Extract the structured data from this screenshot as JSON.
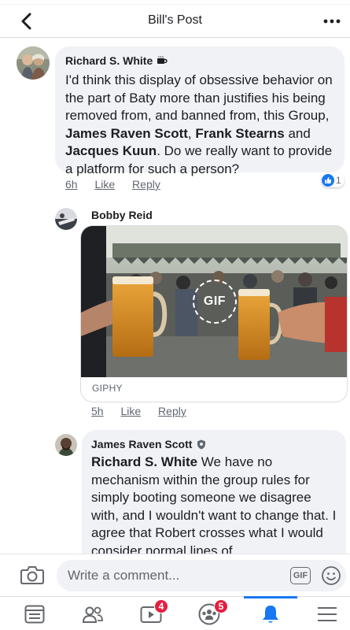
{
  "header": {
    "title": "Bill's Post",
    "back_icon": "chevron-left-icon",
    "more_icon": "more-horizontal-icon"
  },
  "comments": [
    {
      "author": "Richard S. White",
      "author_badge_icon": "coffee-cup-icon",
      "text_parts": [
        {
          "t": "I'd think this display of obsessive behavior on the part of Baty more than justifies his being removed from, and banned from, this Group, ",
          "b": false
        },
        {
          "t": "James Raven Scott",
          "b": true
        },
        {
          "t": ", ",
          "b": false
        },
        {
          "t": "Frank Stearns",
          "b": true
        },
        {
          "t": " and ",
          "b": false
        },
        {
          "t": "Jacques Kuun",
          "b": true
        },
        {
          "t": ". Do we really want to provide a platform for such a person?",
          "b": false
        }
      ],
      "time": "6h",
      "like_label": "Like",
      "reply_label": "Reply",
      "reaction_count": "1"
    },
    {
      "author": "Bobby Reid",
      "gif_badge": "GIF",
      "gif_source": "GIPHY",
      "time": "5h",
      "like_label": "Like",
      "reply_label": "Reply"
    },
    {
      "author": "James Raven Scott",
      "author_badge_icon": "shield-icon",
      "text_parts": [
        {
          "t": "Richard S. White",
          "b": true
        },
        {
          "t": " We have no mechanism within the group rules for simply booting someone we disagree with, and I wouldn't want to change that. I agree that Robert crosses what I would consider normal lines of",
          "b": false
        }
      ]
    }
  ],
  "composer": {
    "placeholder": "Write a comment...",
    "gif_label": "GIF",
    "camera_icon": "camera-icon",
    "emoji_icon": "smiley-icon"
  },
  "bottom_nav": {
    "items": [
      {
        "name": "news-feed",
        "icon": "news-feed-icon",
        "badge": ""
      },
      {
        "name": "friends",
        "icon": "friends-icon",
        "badge": ""
      },
      {
        "name": "watch",
        "icon": "video-play-icon",
        "badge": "4"
      },
      {
        "name": "groups",
        "icon": "groups-icon",
        "badge": "5"
      },
      {
        "name": "notifications",
        "icon": "bell-icon",
        "badge": "",
        "active": true
      },
      {
        "name": "menu",
        "icon": "hamburger-menu-icon",
        "badge": ""
      }
    ]
  },
  "colors": {
    "accent": "#1877f2",
    "bubble": "#f0f2f5",
    "badge": "#e41e3f",
    "muted_text": "#606770"
  }
}
